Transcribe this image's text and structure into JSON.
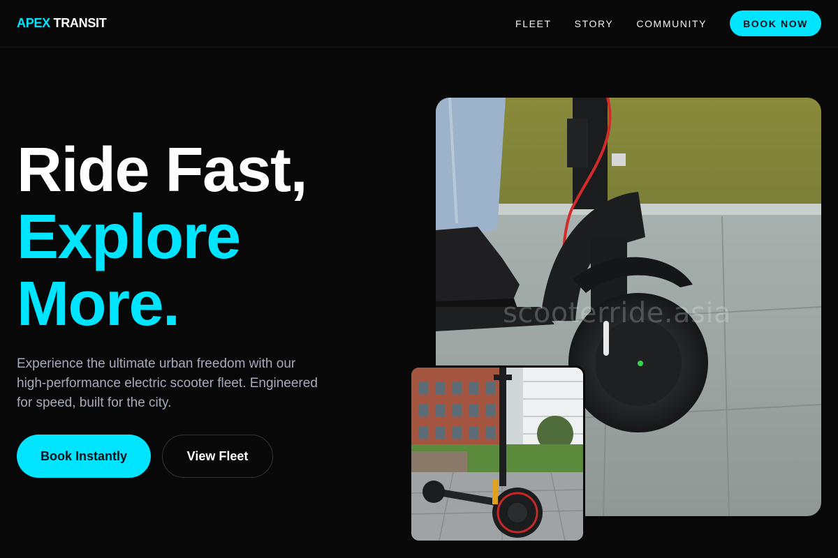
{
  "header": {
    "logo_accent": "APEX",
    "logo_rest": "TRANSIT",
    "nav": [
      "FLEET",
      "STORY",
      "COMMUNITY"
    ],
    "cta": "BOOK NOW"
  },
  "hero": {
    "line1": "Ride Fast,",
    "line2": "Explore",
    "line3": "More.",
    "description": "Experience the ultimate urban freedom with our high-performance electric scooter fleet. Engineered for speed, built for the city.",
    "primary_button": "Book Instantly",
    "secondary_button": "View Fleet"
  },
  "images": {
    "watermark": "scooterride.asia"
  },
  "colors": {
    "accent": "#00e5ff",
    "background": "#080809",
    "muted_text": "#a6aabb"
  }
}
